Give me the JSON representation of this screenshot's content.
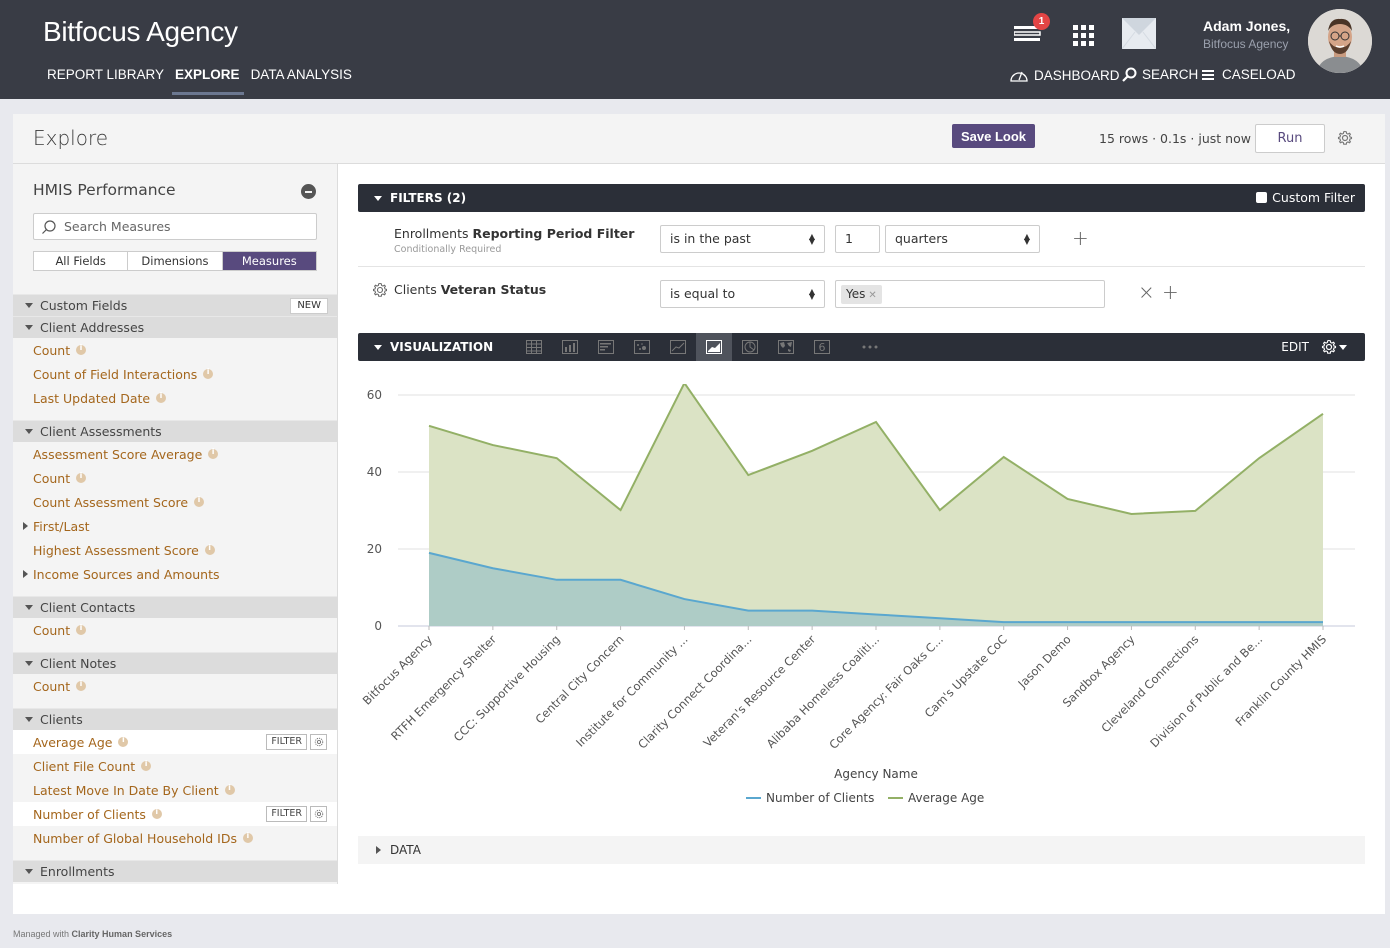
{
  "header": {
    "brand": "Bitfocus Agency",
    "nav": [
      {
        "label": "REPORT LIBRARY",
        "active": false
      },
      {
        "label": "EXPLORE",
        "active": true
      },
      {
        "label": "DATA ANALYSIS",
        "active": false
      }
    ],
    "notification_count": "1",
    "user_name": "Adam Jones,",
    "user_org": "Bitfocus Agency",
    "subnav": [
      {
        "label": "DASHBOARD",
        "icon": "dashboard-gauge-icon"
      },
      {
        "label": "SEARCH",
        "icon": "search-icon"
      },
      {
        "label": "CASELOAD",
        "icon": "list-icon"
      }
    ]
  },
  "page": {
    "title": "Explore",
    "save_look_label": "Save Look",
    "run_meta": "15 rows · 0.1s · just now",
    "run_label": "Run"
  },
  "sidebar": {
    "model_title": "HMIS Performance",
    "search_placeholder": "Search Measures",
    "tabs": [
      {
        "label": "All Fields",
        "active": false
      },
      {
        "label": "Dimensions",
        "active": false
      },
      {
        "label": "Measures",
        "active": true
      }
    ],
    "new_label": "NEW",
    "filter_label": "FILTER",
    "groups": [
      {
        "label": "Custom Fields",
        "has_new": true,
        "fields": []
      },
      {
        "label": "Client Addresses",
        "fields": [
          {
            "label": "Count"
          },
          {
            "label": "Count of Field Interactions"
          },
          {
            "label": "Last Updated Date"
          }
        ]
      },
      {
        "label": "Client Assessments",
        "fields": [
          {
            "label": "Assessment Score Average"
          },
          {
            "label": "Count"
          },
          {
            "label": "Count Assessment Score"
          },
          {
            "label": "First/Last",
            "expandable": true
          },
          {
            "label": "Highest Assessment Score"
          },
          {
            "label": "Income Sources and Amounts",
            "expandable": true
          }
        ]
      },
      {
        "label": "Client Contacts",
        "fields": [
          {
            "label": "Count"
          }
        ]
      },
      {
        "label": "Client Notes",
        "fields": [
          {
            "label": "Count"
          }
        ]
      },
      {
        "label": "Clients",
        "fields": [
          {
            "label": "Average Age",
            "selected": true
          },
          {
            "label": "Client File Count"
          },
          {
            "label": "Latest Move In Date By Client"
          },
          {
            "label": "Number of Clients",
            "selected": true
          },
          {
            "label": "Number of Global Household IDs"
          }
        ]
      },
      {
        "label": "Enrollments",
        "fields": []
      }
    ]
  },
  "filters": {
    "title": "FILTERS (2)",
    "custom_filter_label": "Custom Filter",
    "rows": [
      {
        "view": "Enrollments",
        "field": "Reporting Period Filter",
        "note": "Conditionally Required",
        "operator": "is in the past",
        "value": "1",
        "unit": "quarters"
      },
      {
        "view": "Clients",
        "field": "Veteran Status",
        "operator": "is equal to",
        "chip": "Yes"
      }
    ]
  },
  "visualization": {
    "title": "VISUALIZATION",
    "edit_label": "EDIT",
    "types": [
      {
        "name": "table-viz-icon"
      },
      {
        "name": "column-viz-icon"
      },
      {
        "name": "bar-viz-icon"
      },
      {
        "name": "scatter-viz-icon"
      },
      {
        "name": "line-viz-icon"
      },
      {
        "name": "area-viz-icon",
        "active": true
      },
      {
        "name": "pie-viz-icon"
      },
      {
        "name": "map-viz-icon"
      },
      {
        "name": "single-value-viz-icon",
        "glyph": "6"
      },
      {
        "name": "more-viz-icon"
      }
    ]
  },
  "data_section": {
    "label": "DATA"
  },
  "footer": {
    "prefix": "Managed with ",
    "brand": "Clarity Human Services"
  },
  "chart_data": {
    "type": "area",
    "title": "",
    "xlabel": "Agency Name",
    "ylabel": "",
    "ylim": [
      0,
      60
    ],
    "yticks": [
      0,
      20,
      40,
      60
    ],
    "grid": true,
    "legend_position": "bottom",
    "categories": [
      "Bitfocus Agency",
      "RTFH Emergency Shelter",
      "CCC: Supportive Housing",
      "Central City Concern",
      "Institute for Community ...",
      "Clarity Connect Coordina...",
      "Veteran's Resource Center",
      "Alibaba Homeless Coaliti...",
      "Core Agency: Fair Oaks C...",
      "Cam's Upstate CoC",
      "Jason Demo",
      "Sandbox Agency",
      "Cleveland Connections",
      "Division of Public and Be...",
      "Franklin County HMIS"
    ],
    "series": [
      {
        "name": "Number of Clients",
        "color": "#5aa7cf",
        "fill": "#aeccc6",
        "values": [
          19,
          15,
          12,
          12,
          7,
          4,
          4,
          3,
          2,
          1,
          1,
          1,
          1,
          1,
          1
        ]
      },
      {
        "name": "Average Age",
        "color": "#93b066",
        "fill": "#dbe3c5",
        "values": [
          52,
          47,
          43.6,
          30.1,
          63.1,
          39.2,
          45.5,
          53,
          30.1,
          43.9,
          33,
          29.1,
          29.9,
          43.6,
          55.1
        ]
      }
    ]
  }
}
